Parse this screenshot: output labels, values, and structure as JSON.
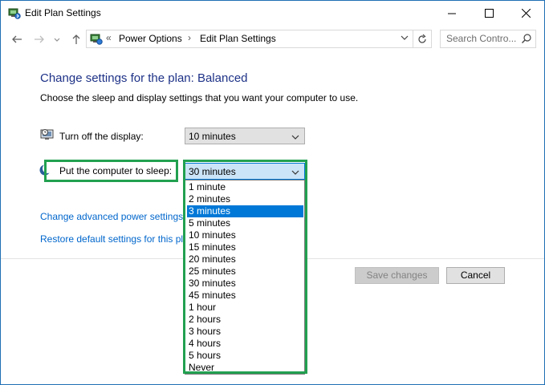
{
  "window": {
    "title": "Edit Plan Settings"
  },
  "address": {
    "chevron": "«",
    "crumbs": [
      "Power Options",
      "Edit Plan Settings"
    ],
    "separator": "›"
  },
  "search": {
    "placeholder": "Search Contro..."
  },
  "page": {
    "heading": "Change settings for the plan: Balanced",
    "subtitle": "Choose the sleep and display settings that you want your computer to use."
  },
  "settings": {
    "display": {
      "label": "Turn off the display:",
      "value": "10 minutes"
    },
    "sleep": {
      "label": "Put the computer to sleep:",
      "value": "30 minutes"
    }
  },
  "links": {
    "advanced": "Change advanced power settings",
    "restore": "Restore default settings for this pla"
  },
  "buttons": {
    "save": "Save changes",
    "cancel": "Cancel"
  },
  "sleep_options": [
    "1 minute",
    "2 minutes",
    "3 minutes",
    "5 minutes",
    "10 minutes",
    "15 minutes",
    "20 minutes",
    "25 minutes",
    "30 minutes",
    "45 minutes",
    "1 hour",
    "2 hours",
    "3 hours",
    "4 hours",
    "5 hours",
    "Never"
  ],
  "sleep_highlighted_option": "3 minutes",
  "colors": {
    "heading": "#1e3287",
    "link": "#0066cc",
    "highlight_box": "#22a050",
    "selection": "#0078d7"
  }
}
